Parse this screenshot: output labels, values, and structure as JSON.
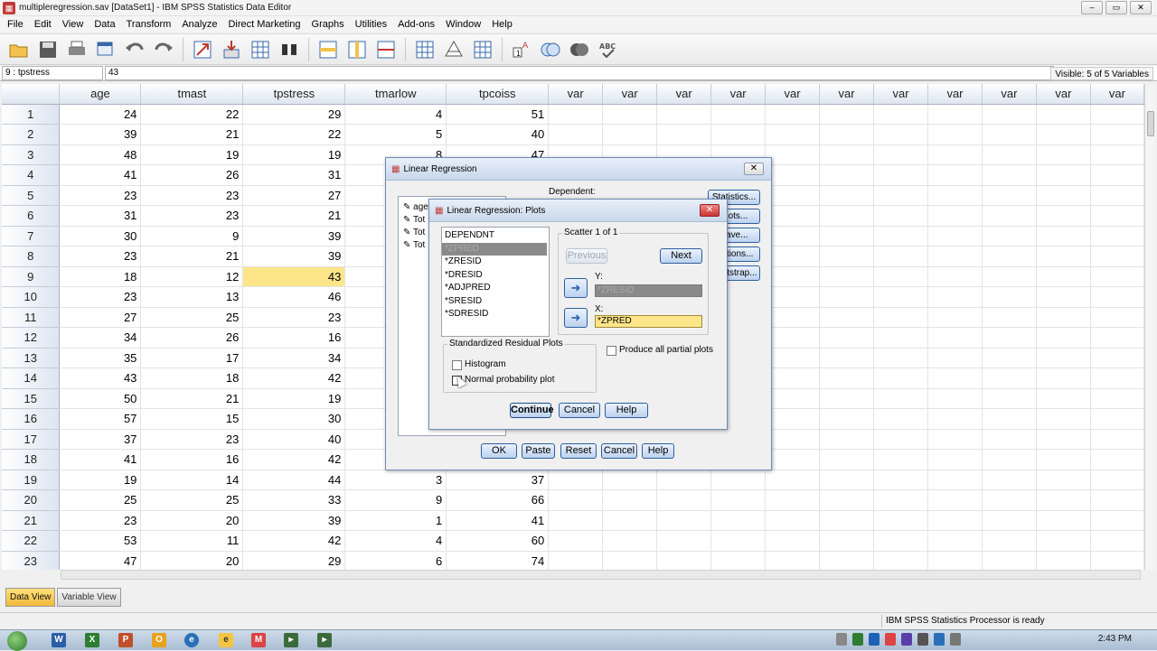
{
  "window": {
    "title": "multipleregression.sav [DataSet1] - IBM SPSS Statistics Data Editor",
    "controls": [
      "–",
      "▭",
      "✕"
    ]
  },
  "menu": [
    "File",
    "Edit",
    "View",
    "Data",
    "Transform",
    "Analyze",
    "Direct Marketing",
    "Graphs",
    "Utilities",
    "Add-ons",
    "Window",
    "Help"
  ],
  "toolbar": {
    "icons": [
      "open-icon",
      "save-icon",
      "print-icon",
      "dialog-recall-icon",
      "undo-icon",
      "redo-icon",
      "goto-case-icon",
      "goto-variable-icon",
      "variables-icon",
      "find-icon",
      "insert-cases-icon",
      "insert-variable-icon",
      "split-file-icon",
      "weight-cases-icon",
      "select-cases-icon",
      "value-labels-icon",
      "use-sets-icon",
      "show-all-icon",
      "spell-check-icon"
    ]
  },
  "cell_editor": {
    "ref": "9 : tpstress",
    "value": "43",
    "visible": "Visible: 5 of 5 Variables"
  },
  "grid": {
    "columns": [
      "age",
      "tmast",
      "tpstress",
      "tmarlow",
      "tpcoiss",
      "var",
      "var",
      "var",
      "var",
      "var",
      "var",
      "var",
      "var",
      "var",
      "var",
      "var"
    ],
    "rows": [
      [
        "1",
        "24",
        "22",
        "29",
        "4",
        "51"
      ],
      [
        "2",
        "39",
        "21",
        "22",
        "5",
        "40"
      ],
      [
        "3",
        "48",
        "19",
        "19",
        "8",
        "47"
      ],
      [
        "4",
        "41",
        "26",
        "31",
        "",
        ""
      ],
      [
        "5",
        "23",
        "23",
        "27",
        "",
        ""
      ],
      [
        "6",
        "31",
        "23",
        "21",
        "",
        ""
      ],
      [
        "7",
        "30",
        "9",
        "39",
        "",
        ""
      ],
      [
        "8",
        "23",
        "21",
        "39",
        "",
        ""
      ],
      [
        "9",
        "18",
        "12",
        "43",
        "",
        ""
      ],
      [
        "10",
        "23",
        "13",
        "46",
        "",
        ""
      ],
      [
        "11",
        "27",
        "25",
        "23",
        "",
        ""
      ],
      [
        "12",
        "34",
        "26",
        "16",
        "",
        ""
      ],
      [
        "13",
        "35",
        "17",
        "34",
        "",
        ""
      ],
      [
        "14",
        "43",
        "18",
        "42",
        "",
        ""
      ],
      [
        "15",
        "50",
        "21",
        "19",
        "",
        ""
      ],
      [
        "16",
        "57",
        "15",
        "30",
        "",
        ""
      ],
      [
        "17",
        "37",
        "23",
        "40",
        "",
        ""
      ],
      [
        "18",
        "41",
        "16",
        "42",
        "",
        ""
      ],
      [
        "19",
        "19",
        "14",
        "44",
        "3",
        "37"
      ],
      [
        "20",
        "25",
        "25",
        "33",
        "9",
        "66"
      ],
      [
        "21",
        "23",
        "20",
        "39",
        "1",
        "41"
      ],
      [
        "22",
        "53",
        "11",
        "42",
        "4",
        "60"
      ],
      [
        "23",
        "47",
        "20",
        "29",
        "6",
        "74"
      ]
    ],
    "selected_row": 9,
    "selected_col": "tpstress"
  },
  "view_tabs": [
    "Data View",
    "Variable View"
  ],
  "status": "IBM SPSS Statistics Processor is ready",
  "taskbar": {
    "clock": "2:43 PM"
  },
  "linear_regression": {
    "title": "Linear Regression",
    "dependent_label": "Dependent:",
    "variables": [
      "age",
      "Tot",
      "Tot",
      "Tot"
    ],
    "side_buttons": [
      "Statistics...",
      "Plots...",
      "Save...",
      "Options...",
      "Bootstrap..."
    ],
    "buttons": [
      "OK",
      "Paste",
      "Reset",
      "Cancel",
      "Help"
    ]
  },
  "plots_dialog": {
    "title": "Linear Regression: Plots",
    "source_list": [
      "DEPENDNT",
      "*ZPRED",
      "*ZRESID",
      "*DRESID",
      "*ADJPRED",
      "*SRESID",
      "*SDRESID"
    ],
    "selected_source_index": 1,
    "scatter_label": "Scatter 1 of 1",
    "previous_label": "Previous",
    "next_label": "Next",
    "y_label": "Y:",
    "y_value": "*ZRESID",
    "x_label": "X:",
    "x_value": "*ZPRED",
    "residual_group": "Standardized Residual Plots",
    "histogram_label": "Histogram",
    "normal_label": "Normal probability plot",
    "partial_label": "Produce all partial plots",
    "buttons": [
      "Continue",
      "Cancel",
      "Help"
    ]
  }
}
